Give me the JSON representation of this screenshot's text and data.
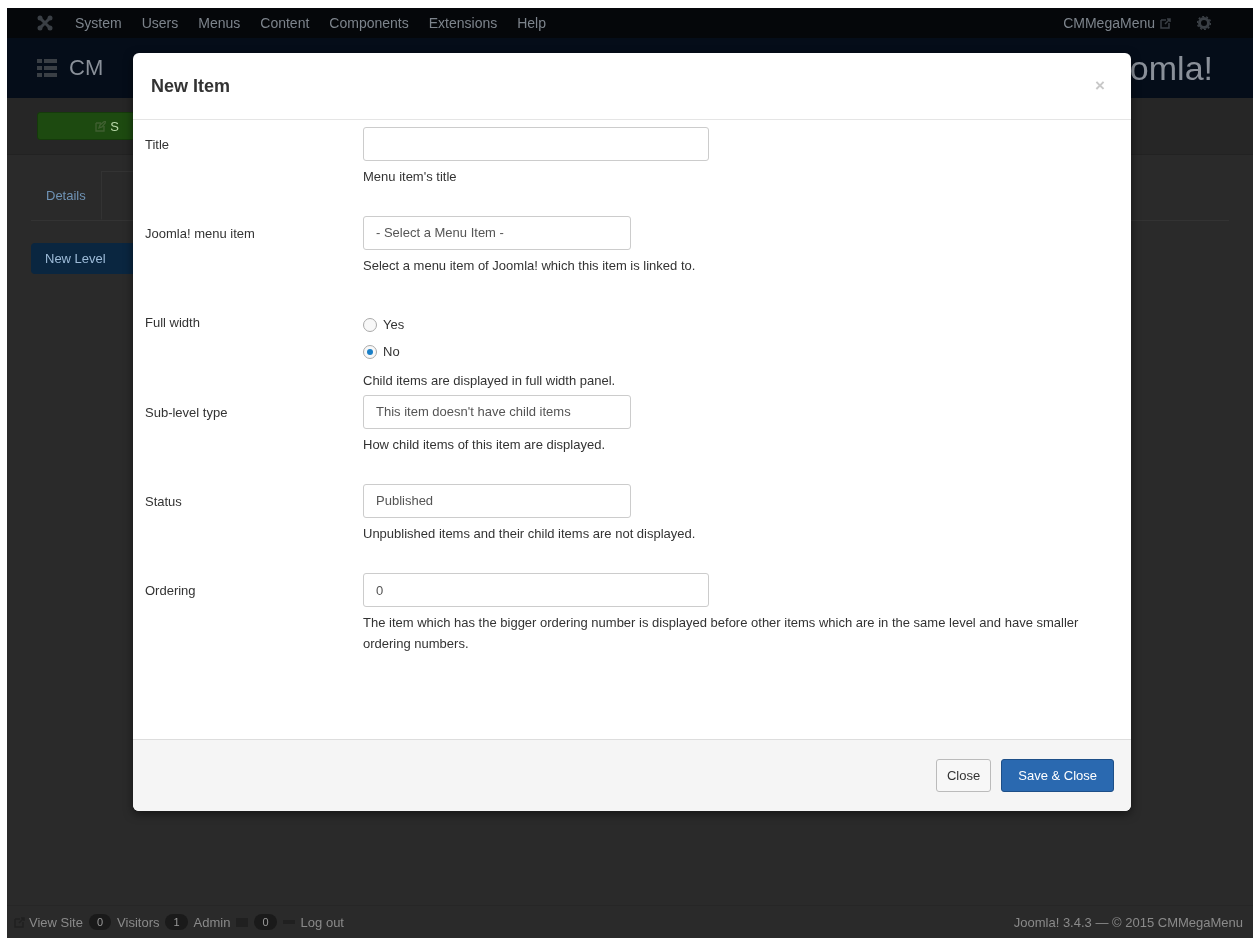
{
  "navbar": {
    "menus": [
      "System",
      "Users",
      "Menus",
      "Content",
      "Components",
      "Extensions",
      "Help"
    ],
    "site_link": "CMMegaMenu"
  },
  "header": {
    "title": "CM",
    "logo_text": "omla!"
  },
  "toolbar": {
    "save_button": "S"
  },
  "tabs": [
    {
      "label": "Details",
      "selected": false
    },
    {
      "selected": true
    }
  ],
  "level_button": "New Level",
  "modal": {
    "title": "New Item",
    "close_symbol": "×",
    "fields": [
      {
        "kind": "text",
        "label": "Title",
        "help": "Menu item's title"
      },
      {
        "kind": "select",
        "label": "Joomla! menu item",
        "value": "- Select a Menu Item -",
        "help": "Select a menu item of Joomla! which this item is linked to."
      },
      {
        "kind": "radio",
        "label": "Full width",
        "options": [
          {
            "label": "Yes",
            "selected": false
          },
          {
            "label": "No",
            "selected": true
          }
        ],
        "help": "Child items are displayed in full width panel."
      },
      {
        "kind": "select",
        "label": "Sub-level type",
        "value": "This item doesn't have child items",
        "help": "How child items of this item are displayed."
      },
      {
        "kind": "select",
        "label": "Status",
        "value": "Published",
        "help": "Unpublished items and their child items are not displayed."
      },
      {
        "kind": "text",
        "label": "Ordering",
        "value": "0",
        "help": "The item which has the bigger ordering number is displayed before other items which are in the same level and have smaller ordering numbers."
      }
    ],
    "buttons": [
      {
        "label": "Close",
        "kind": "default"
      },
      {
        "label": "Save & Close",
        "kind": "primary"
      }
    ]
  },
  "footer": {
    "view_site": "View Site",
    "visitors_count": "0",
    "visitors": "Visitors",
    "admin_count": "1",
    "admin": "Admin",
    "messages_count": "0",
    "logout": "Log out",
    "version": "Joomla! 3.4.3 — © 2015 CMMegaMenu"
  }
}
